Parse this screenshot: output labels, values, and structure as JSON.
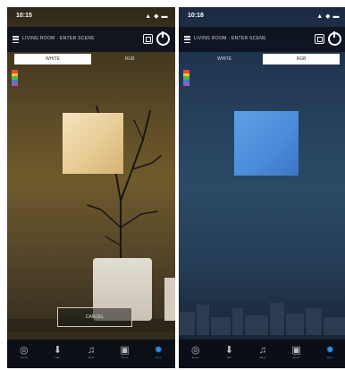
{
  "screens": [
    {
      "status": {
        "time": "10:15",
        "icons": "▲ ◆ ▬"
      },
      "header": {
        "title": "LIVING ROOM · ENTER SCENE"
      },
      "tabs": [
        {
          "label": "WHITE",
          "active": true
        },
        {
          "label": "RGB",
          "active": false
        }
      ],
      "palette_colors": [
        "#e84a3c",
        "#f1c232",
        "#4fb64a",
        "#3d7de0",
        "#9b59b6"
      ],
      "tile_color": "#e7cc93",
      "overlay_label": "CANCEL",
      "nav": [
        {
          "icon": "music-icon",
          "glyph": "◎",
          "label": "Scene"
        },
        {
          "icon": "mic-icon",
          "glyph": "⬇",
          "label": "Mic"
        },
        {
          "icon": "music-note-icon",
          "glyph": "♫",
          "label": "Music"
        },
        {
          "icon": "picture-icon",
          "glyph": "▣",
          "label": "Photo"
        },
        {
          "icon": "settings-icon",
          "glyph": "✹",
          "label": "More",
          "selected": true
        }
      ]
    },
    {
      "status": {
        "time": "10:18",
        "icons": "▲ ◆ ▬"
      },
      "header": {
        "title": "LIVING ROOM · ENTER SCENE"
      },
      "tabs": [
        {
          "label": "WHITE",
          "active": false
        },
        {
          "label": "RGB",
          "active": true
        }
      ],
      "palette_colors": [
        "#e84a3c",
        "#f1c232",
        "#4fb64a",
        "#3d7de0",
        "#9b59b6"
      ],
      "tile_color": "#4b8bd8",
      "nav": [
        {
          "icon": "music-icon",
          "glyph": "◎",
          "label": "Scene"
        },
        {
          "icon": "mic-icon",
          "glyph": "⬇",
          "label": "Mic"
        },
        {
          "icon": "music-note-icon",
          "glyph": "♫",
          "label": "Music"
        },
        {
          "icon": "picture-icon",
          "glyph": "▣",
          "label": "Photo"
        },
        {
          "icon": "settings-icon",
          "glyph": "✹",
          "label": "More",
          "selected": true
        }
      ]
    }
  ]
}
